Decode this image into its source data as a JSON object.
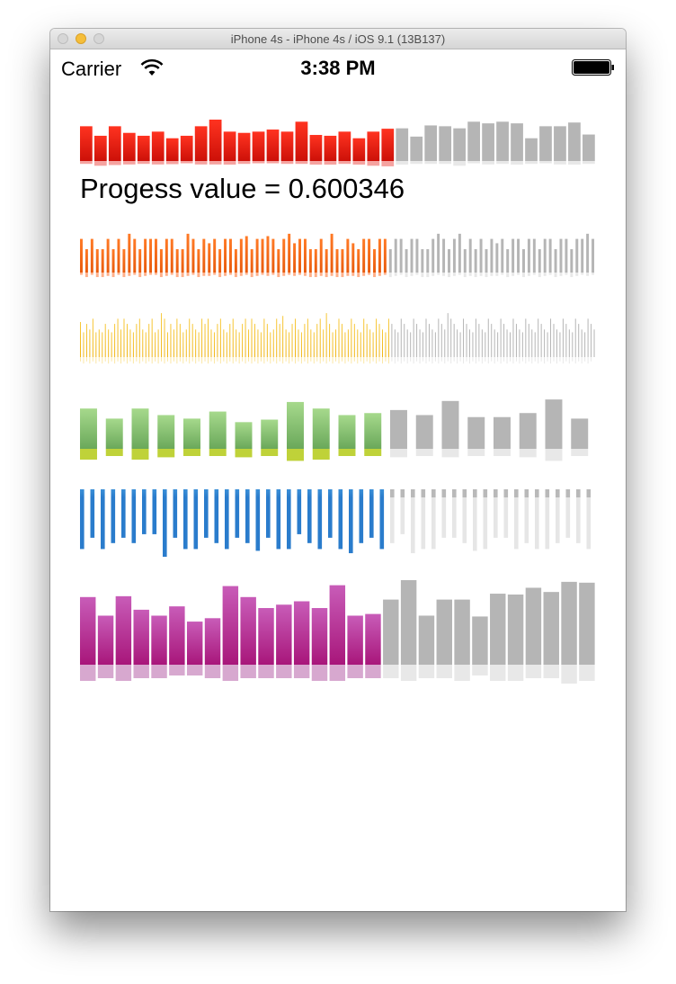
{
  "window": {
    "title": "iPhone 4s - iPhone 4s / iOS 9.1 (13B137)"
  },
  "status_bar": {
    "carrier": "Carrier",
    "time": "3:38 PM",
    "wifi_icon": "wifi-icon",
    "battery_icon": "battery-icon"
  },
  "progress_label": "Progess value = 0.600346",
  "progress": 0.600346,
  "waveforms": [
    {
      "name": "red",
      "top_color_start": "#ff3320",
      "top_color_end": "#cc1008",
      "bottom_color": "#f5a3a0",
      "inactive_color": "#b5b5b5",
      "inactive_bottom_color": "#e8e8e8",
      "top": [
        0.84,
        0.61,
        0.84,
        0.68,
        0.61,
        0.71,
        0.55,
        0.61,
        0.84,
        1.0,
        0.71,
        0.68,
        0.71,
        0.76,
        0.71,
        0.95,
        0.63,
        0.61,
        0.71,
        0.55,
        0.71,
        0.78,
        0.79,
        0.59,
        0.86,
        0.84,
        0.79,
        0.95,
        0.91,
        0.95,
        0.91,
        0.55,
        0.84,
        0.84,
        0.93,
        0.64
      ],
      "bottom": [
        0.2,
        0.33,
        0.28,
        0.24,
        0.2,
        0.24,
        0.22,
        0.16,
        0.24,
        0.24,
        0.25,
        0.2,
        0.16,
        0.16,
        0.2,
        0.2,
        0.25,
        0.25,
        0.2,
        0.25,
        0.33,
        0.37,
        0.25,
        0.2,
        0.2,
        0.2,
        0.33,
        0.16,
        0.24,
        0.2,
        0.25,
        0.2,
        0.16,
        0.24,
        0.25,
        0.2
      ]
    },
    {
      "name": "orange",
      "top_color_start": "#ff7a26",
      "top_color_end": "#e85a0c",
      "bottom_color": "#ffb08a",
      "inactive_color": "#b5b5b5",
      "inactive_bottom_color": "#e8e8e8",
      "top": [
        0.85,
        0.59,
        0.85,
        0.59,
        0.59,
        0.85,
        0.59,
        0.85,
        0.59,
        0.98,
        0.85,
        0.59,
        0.85,
        0.85,
        0.85,
        0.59,
        0.85,
        0.85,
        0.59,
        0.59,
        0.98,
        0.85,
        0.59,
        0.85,
        0.74,
        0.85,
        0.59,
        0.85,
        0.85,
        0.59,
        0.85,
        0.92,
        0.59,
        0.85,
        0.85,
        0.92,
        0.85,
        0.59,
        0.85,
        0.98,
        0.74,
        0.85,
        0.85,
        0.59,
        0.59,
        0.85,
        0.59,
        0.98,
        0.59,
        0.59,
        0.85,
        0.74,
        0.59,
        0.85,
        0.85,
        0.59,
        0.85,
        0.85,
        0.59,
        0.85,
        0.85,
        0.59,
        0.85,
        0.85,
        0.59,
        0.59,
        0.85,
        0.98,
        0.85,
        0.59,
        0.85,
        0.98,
        0.59,
        0.85,
        0.59,
        0.85,
        0.59,
        0.85,
        0.74,
        0.85,
        0.59,
        0.85,
        0.85,
        0.59,
        0.85,
        0.85,
        0.59,
        0.85,
        0.85,
        0.59,
        0.85,
        0.85,
        0.59,
        0.85,
        0.85,
        0.98,
        0.85
      ],
      "bottom": [
        0.18,
        0.36,
        0.18,
        0.36,
        0.36,
        0.27,
        0.36,
        0.18,
        0.36,
        0.27,
        0.18,
        0.36,
        0.27,
        0.18,
        0.18,
        0.36,
        0.27,
        0.18,
        0.36,
        0.36,
        0.27,
        0.18,
        0.36,
        0.27,
        0.27,
        0.18,
        0.36,
        0.27,
        0.18,
        0.36,
        0.27,
        0.18,
        0.36,
        0.27,
        0.18,
        0.27,
        0.18,
        0.36,
        0.27,
        0.18,
        0.27,
        0.18,
        0.27,
        0.36,
        0.36,
        0.27,
        0.36,
        0.27,
        0.36,
        0.36,
        0.27,
        0.27,
        0.36,
        0.27,
        0.18,
        0.36,
        0.27,
        0.18,
        0.36,
        0.27,
        0.18,
        0.36,
        0.27,
        0.18,
        0.36,
        0.36,
        0.27,
        0.18,
        0.27,
        0.36,
        0.27,
        0.18,
        0.36,
        0.27,
        0.36,
        0.27,
        0.36,
        0.27,
        0.27,
        0.18,
        0.36,
        0.27,
        0.18,
        0.36,
        0.27,
        0.18,
        0.36,
        0.27,
        0.18,
        0.36,
        0.27,
        0.18,
        0.36,
        0.27,
        0.18,
        0.27,
        0.18
      ]
    },
    {
      "name": "yellow",
      "top_color_start": "#f7c83a",
      "top_color_end": "#f0b410",
      "bottom_color": "#fbe7a5",
      "inactive_color": "#b5b5b5",
      "inactive_bottom_color": "#e8e8e8",
      "top": [
        0.75,
        0.53,
        0.71,
        0.59,
        0.82,
        0.53,
        0.59,
        0.53,
        0.71,
        0.59,
        0.53,
        0.71,
        0.82,
        0.59,
        0.82,
        0.71,
        0.59,
        0.53,
        0.71,
        0.82,
        0.59,
        0.53,
        0.71,
        0.82,
        0.53,
        0.59,
        0.94,
        0.82,
        0.53,
        0.71,
        0.59,
        0.82,
        0.71,
        0.53,
        0.59,
        0.82,
        0.71,
        0.59,
        0.53,
        0.82,
        0.71,
        0.82,
        0.59,
        0.53,
        0.71,
        0.82,
        0.59,
        0.53,
        0.71,
        0.82,
        0.59,
        0.53,
        0.71,
        0.82,
        0.59,
        0.82,
        0.71,
        0.59,
        0.53,
        0.82,
        0.71,
        0.53,
        0.59,
        0.82,
        0.71,
        0.88,
        0.59,
        0.53,
        0.71,
        0.82,
        0.59,
        0.53,
        0.71,
        0.82,
        0.59,
        0.53,
        0.71,
        0.82,
        0.59,
        0.94,
        0.71,
        0.53,
        0.59,
        0.82,
        0.71,
        0.53,
        0.59,
        0.82,
        0.71,
        0.59,
        0.53,
        0.82,
        0.71,
        0.59,
        0.53,
        0.82,
        0.71,
        0.59,
        0.53,
        0.82,
        0.71,
        0.59,
        0.53,
        0.82,
        0.71,
        0.59,
        0.53,
        0.82,
        0.71,
        0.59,
        0.53,
        0.82,
        0.71,
        0.59,
        0.53,
        0.82,
        0.71,
        0.59,
        0.94,
        0.82,
        0.71,
        0.59,
        0.53,
        0.82,
        0.71,
        0.59,
        0.53,
        0.82,
        0.71,
        0.59,
        0.53,
        0.82,
        0.71,
        0.59,
        0.53,
        0.82,
        0.71,
        0.59,
        0.53,
        0.82,
        0.71,
        0.59,
        0.53,
        0.82,
        0.71,
        0.59,
        0.53,
        0.82,
        0.71,
        0.59,
        0.53,
        0.82,
        0.71,
        0.59,
        0.53,
        0.82,
        0.71,
        0.59,
        0.53,
        0.82,
        0.71,
        0.59,
        0.53,
        0.82,
        0.71,
        0.59
      ],
      "bottom": [
        0.4,
        0.6,
        0.4,
        0.6,
        0.4,
        0.6,
        0.4,
        0.6,
        0.4,
        0.6,
        0.4,
        0.6,
        0.4,
        0.6,
        0.4,
        0.6,
        0.4,
        0.6,
        0.4,
        0.6,
        0.4,
        0.6,
        0.4,
        0.6,
        0.4,
        0.6,
        0.4,
        0.6,
        0.4,
        0.6,
        0.4,
        0.6,
        0.4,
        0.6,
        0.4,
        0.6,
        0.4,
        0.6,
        0.4,
        0.6,
        0.4,
        0.6,
        0.4,
        0.6,
        0.4,
        0.6,
        0.4,
        0.6,
        0.4,
        0.6,
        0.4,
        0.6,
        0.4,
        0.6,
        0.4,
        0.6,
        0.4,
        0.6,
        0.4,
        0.6,
        0.4,
        0.6,
        0.4,
        0.6,
        0.4,
        0.6,
        0.4,
        0.6,
        0.4,
        0.6,
        0.4,
        0.6,
        0.4,
        0.6,
        0.4,
        0.6,
        0.4,
        0.6,
        0.4,
        0.6,
        0.4,
        0.6,
        0.4,
        0.6,
        0.4,
        0.6,
        0.4,
        0.6,
        0.4,
        0.6,
        0.4,
        0.6,
        0.4,
        0.6,
        0.4,
        0.6,
        0.4,
        0.6,
        0.4,
        0.6,
        0.4,
        0.6,
        0.4,
        0.6,
        0.4,
        0.6,
        0.4,
        0.6,
        0.4,
        0.6,
        0.4,
        0.6,
        0.4,
        0.6,
        0.4,
        0.6,
        0.4,
        0.6,
        0.4,
        0.6,
        0.4,
        0.6,
        0.4,
        0.6,
        0.4,
        0.6,
        0.4,
        0.6,
        0.4,
        0.6,
        0.4,
        0.6,
        0.4,
        0.6,
        0.4,
        0.6,
        0.4,
        0.6,
        0.4,
        0.6,
        0.4,
        0.6,
        0.4,
        0.6,
        0.4,
        0.6,
        0.4,
        0.6,
        0.4,
        0.6,
        0.4,
        0.6,
        0.4,
        0.6,
        0.4,
        0.6,
        0.4,
        0.6,
        0.4,
        0.6,
        0.4,
        0.6,
        0.4,
        0.6,
        0.4
      ]
    },
    {
      "name": "green",
      "top_color_start": "#a6d98c",
      "top_color_end": "#6aa85a",
      "bottom_color": "#bfd239",
      "inactive_color": "#b5b5b5",
      "inactive_bottom_color": "#e8e8e8",
      "top": [
        0.8,
        0.6,
        0.8,
        0.67,
        0.6,
        0.74,
        0.53,
        0.58,
        0.93,
        0.8,
        0.67,
        0.71,
        0.77,
        0.67,
        0.95,
        0.63,
        0.63,
        0.71,
        0.98,
        0.6
      ],
      "bottom": [
        0.6,
        0.4,
        0.6,
        0.47,
        0.4,
        0.4,
        0.47,
        0.4,
        0.67,
        0.6,
        0.4,
        0.4,
        0.47,
        0.4,
        0.47,
        0.4,
        0.4,
        0.47,
        0.67,
        0.4
      ]
    },
    {
      "name": "blue",
      "top_color_start": "#3a8fd8",
      "top_color_end": "#2a7ccc",
      "bottom_color": "#2a7ccc",
      "inactive_color": "#b9b9b9",
      "inactive_bottom_color": "#e6e6e6",
      "top": [
        0.5,
        0.5,
        0.5,
        0.5,
        0.5,
        0.5,
        0.5,
        0.5,
        0.5,
        0.5,
        0.5,
        0.5,
        0.5,
        0.5,
        0.5,
        0.5,
        0.5,
        0.5,
        0.5,
        0.5,
        0.5,
        0.5,
        0.5,
        0.5,
        0.5,
        0.5,
        0.5,
        0.5,
        0.5,
        0.5,
        0.5,
        0.5,
        0.5,
        0.5,
        0.5,
        0.5,
        0.5,
        0.5,
        0.5,
        0.5,
        0.5,
        0.5,
        0.5,
        0.5,
        0.5,
        0.5,
        0.5,
        0.5,
        0.5,
        0.5
      ],
      "bottom": [
        0.87,
        0.68,
        0.87,
        0.77,
        0.68,
        0.77,
        0.62,
        0.62,
        1.0,
        0.68,
        0.87,
        0.87,
        0.68,
        0.77,
        0.87,
        0.68,
        0.77,
        0.9,
        0.68,
        0.87,
        0.87,
        0.62,
        0.77,
        0.87,
        0.68,
        0.87,
        0.94,
        0.77,
        0.68,
        0.87,
        0.77,
        0.62,
        0.94,
        0.87,
        0.87,
        0.68,
        0.68,
        0.77,
        0.9,
        0.87,
        0.68,
        0.68,
        0.87,
        0.77,
        0.87,
        0.87,
        0.77,
        0.68,
        0.77,
        0.87
      ]
    },
    {
      "name": "magenta",
      "top_color_start": "#c85cb8",
      "top_color_end": "#a8167a",
      "bottom_color": "#d7a8cf",
      "inactive_color": "#b5b5b5",
      "inactive_bottom_color": "#e8e8e8",
      "top": [
        0.8,
        0.58,
        0.81,
        0.65,
        0.58,
        0.69,
        0.51,
        0.55,
        0.93,
        0.8,
        0.67,
        0.71,
        0.75,
        0.67,
        0.94,
        0.58,
        0.6,
        0.77,
        1.0,
        0.58,
        0.77,
        0.77,
        0.57,
        0.84,
        0.83,
        0.91,
        0.86,
        0.98,
        0.97
      ],
      "bottom": [
        0.6,
        0.5,
        0.6,
        0.5,
        0.5,
        0.4,
        0.4,
        0.5,
        0.6,
        0.5,
        0.5,
        0.5,
        0.5,
        0.6,
        0.6,
        0.5,
        0.5,
        0.5,
        0.6,
        0.5,
        0.5,
        0.6,
        0.4,
        0.6,
        0.6,
        0.5,
        0.5,
        0.7,
        0.6
      ]
    }
  ]
}
